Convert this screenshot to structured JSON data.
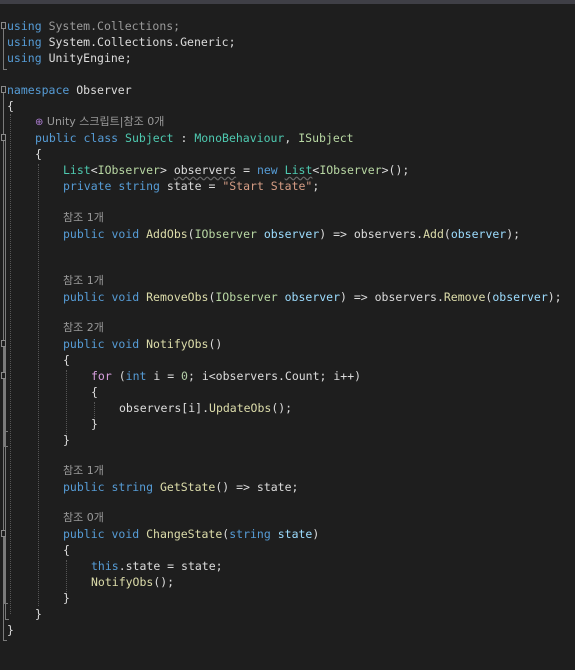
{
  "theme": {
    "background": "#1e1e1e",
    "keyword": "#569cd6",
    "type": "#4ec9b0",
    "interface": "#b8d7a3",
    "string": "#d69d85",
    "method": "#dcdcaa",
    "parameter": "#9cdcfe",
    "number": "#b5cea8",
    "control": "#d8a0df",
    "codelens": "#9a9a9a"
  },
  "code": {
    "using1_kw": "using",
    "using1_ns": "System.Collections;",
    "using2_kw": "using",
    "using2_ns": "System.Collections.Generic;",
    "using3_kw": "using",
    "using3_ns": "UnityEngine;",
    "namespace_kw": "namespace",
    "namespace_name": "Observer",
    "brace_open": "{",
    "brace_close": "}",
    "lens_class_icon": "⊕",
    "lens_class": "Unity 스크립트|참조 0개",
    "class_public": "public",
    "class_kw": "class",
    "class_name": "Subject",
    "class_colon": ":",
    "class_base": "MonoBehaviour",
    "class_comma": ",",
    "class_iface": "ISubject",
    "field1_list": "List",
    "field1_lt": "<",
    "field1_iobs": "IObserver",
    "field1_gt": ">",
    "field1_name": "observers",
    "field1_eq": "=",
    "field1_new": "new",
    "field1_list2": "List",
    "field1_lt2": "<",
    "field1_iobs2": "IObserver",
    "field1_end": ">();",
    "field2_private": "private",
    "field2_string": "string",
    "field2_name": "state",
    "field2_eq": "=",
    "field2_value": "\"Start State\"",
    "field2_semi": ";",
    "lens_add": "참조 1개",
    "add_public": "public",
    "add_void": "void",
    "add_name": "AddObs",
    "add_paren": "(",
    "add_ptype": "IObserver",
    "add_pname": "observer",
    "add_arrow": ") => observers.",
    "add_call": "Add",
    "add_paren2": "(",
    "add_arg": "observer",
    "add_end": ");",
    "lens_remove": "참조 1개",
    "rem_public": "public",
    "rem_void": "void",
    "rem_name": "RemoveObs",
    "rem_paren": "(",
    "rem_ptype": "IObserver",
    "rem_pname": "observer",
    "rem_arrow": ") => observers.",
    "rem_call": "Remove",
    "rem_paren2": "(",
    "rem_arg": "observer",
    "rem_end": ");",
    "lens_notify": "참조 2개",
    "not_public": "public",
    "not_void": "void",
    "not_name": "NotifyObs",
    "not_paren": "()",
    "for_kw": "for",
    "for_open": " (",
    "for_int": "int",
    "for_rest": " i = ",
    "for_zero": "0",
    "for_cond": "; i<observers.Count; i++)",
    "call_obj": "observers[i].",
    "call_name": "UpdateObs",
    "call_end": "();",
    "lens_get": "참조 1개",
    "get_public": "public",
    "get_string": "string",
    "get_name": "GetState",
    "get_rest": "() => state;",
    "lens_change": "참조 0개",
    "chg_public": "public",
    "chg_void": "void",
    "chg_name": "ChangeState",
    "chg_paren": "(",
    "chg_ptype": "string",
    "chg_pname": "state",
    "chg_end": ")",
    "this_kw": "this",
    "this_rest": ".state = state;",
    "notify_call": "NotifyObs",
    "notify_end": "();"
  }
}
